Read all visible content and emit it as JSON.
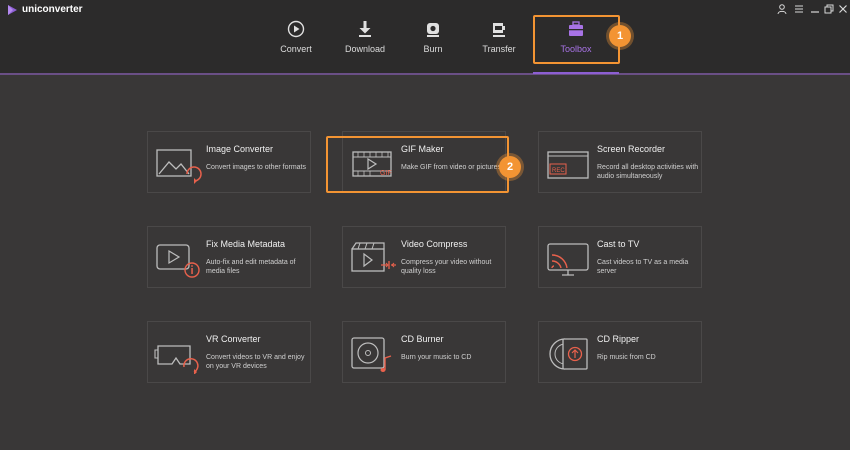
{
  "app": {
    "name": "uniconverter"
  },
  "window_controls": {
    "user": "user-icon",
    "menu": "menu-icon",
    "minimize": "minimize-icon",
    "maximize": "maximize-icon",
    "close": "close-icon"
  },
  "nav": {
    "tabs": [
      {
        "label": "Convert",
        "icon": "convert-icon"
      },
      {
        "label": "Download",
        "icon": "download-icon"
      },
      {
        "label": "Burn",
        "icon": "burn-icon"
      },
      {
        "label": "Transfer",
        "icon": "transfer-icon"
      },
      {
        "label": "Toolbox",
        "icon": "toolbox-icon"
      }
    ],
    "active": "Toolbox",
    "accent_color": "#a873e6"
  },
  "callouts": [
    {
      "number": "1"
    },
    {
      "number": "2"
    }
  ],
  "callout_color": "#f39433",
  "tools": [
    {
      "title": "Image Converter",
      "desc": "Convert images to other formats",
      "icon": "image-converter-icon"
    },
    {
      "title": "GIF Maker",
      "desc": "Make GIF from video or pictures",
      "icon": "gif-maker-icon"
    },
    {
      "title": "Screen Recorder",
      "desc": "Record all desktop activities with audio simultaneously",
      "icon": "screen-recorder-icon"
    },
    {
      "title": "Fix Media Metadata",
      "desc": "Auto-fix and edit metadata of media files",
      "icon": "fix-metadata-icon"
    },
    {
      "title": "Video Compress",
      "desc": "Compress your video without quality loss",
      "icon": "video-compress-icon"
    },
    {
      "title": "Cast to TV",
      "desc": "Cast videos to TV as a media server",
      "icon": "cast-tv-icon"
    },
    {
      "title": "VR Converter",
      "desc": "Convert videos to VR and enjoy on your VR devices",
      "icon": "vr-converter-icon"
    },
    {
      "title": "CD Burner",
      "desc": "Burn your music to CD",
      "icon": "cd-burner-icon"
    },
    {
      "title": "CD Ripper",
      "desc": "Rip music from CD",
      "icon": "cd-ripper-icon"
    }
  ]
}
